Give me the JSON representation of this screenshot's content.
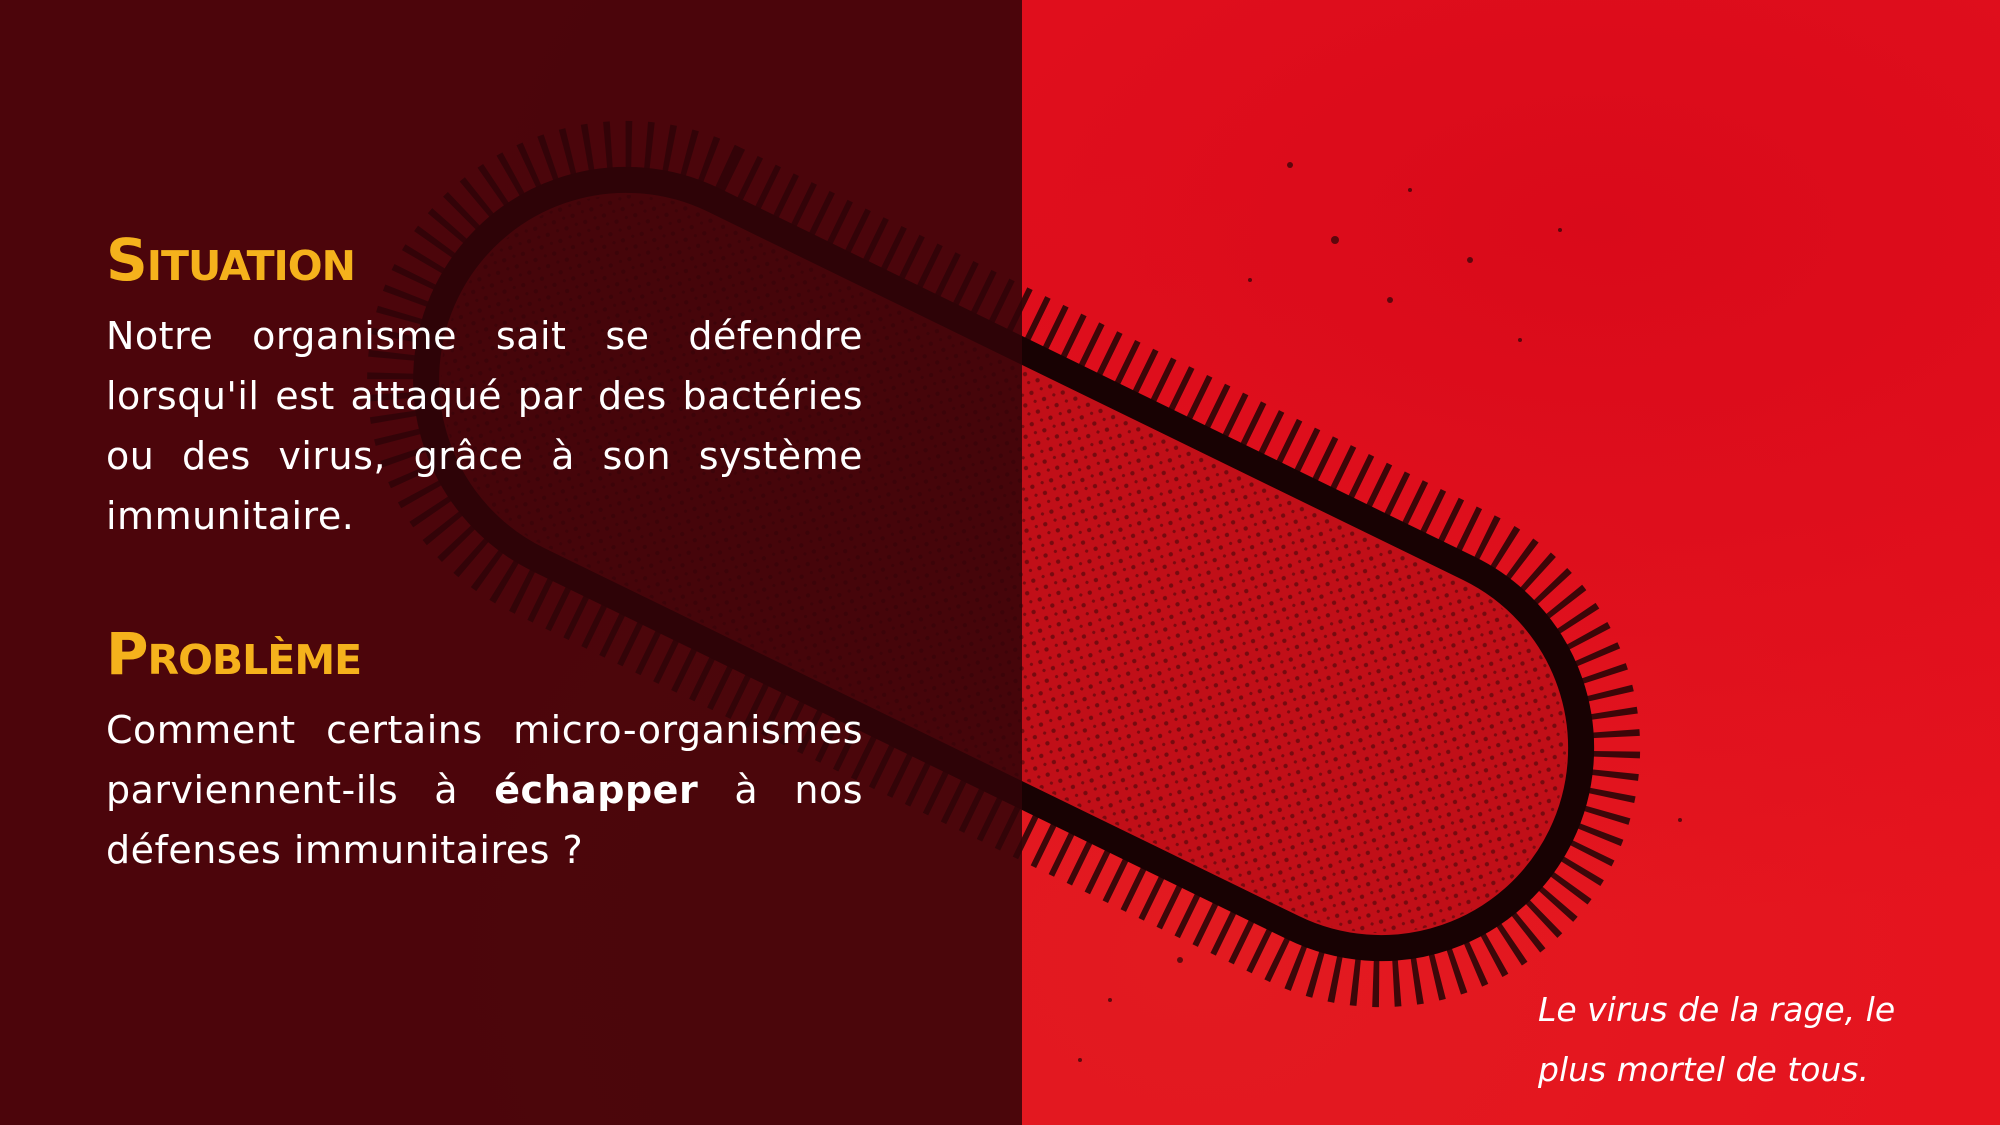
{
  "slide": {
    "situation": {
      "title": "Situation",
      "text": "Notre organisme sait se défendre lorsqu'il est attaqué par des bactéries ou des virus, grâce à son système immunitaire."
    },
    "probleme": {
      "title": "Problème",
      "text_before": "Comment certains micro-organismes parviennent-ils à ",
      "text_bold": "échapper",
      "text_after": " à nos défenses immunitaires ?"
    },
    "caption": {
      "line1": "Le virus de la rage, le",
      "line2": "plus mortel de tous."
    }
  },
  "colors": {
    "heading": "#f5b21c",
    "background_red": "#e6121e",
    "panel_dark": "#320408",
    "text": "#ffffff"
  },
  "image": {
    "subject": "rabies-virus-micrograph"
  }
}
